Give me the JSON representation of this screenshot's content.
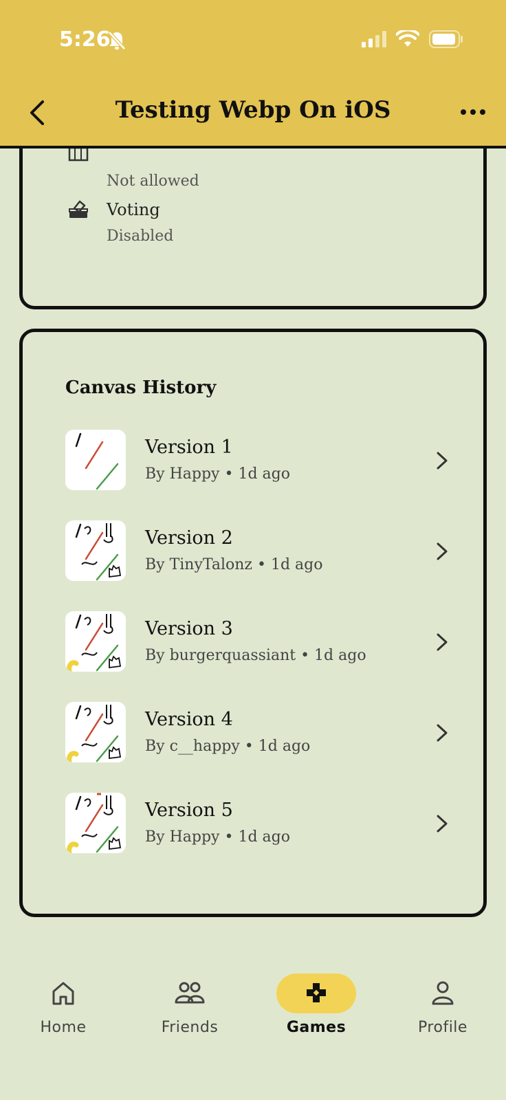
{
  "status_bar": {
    "time": "5:26"
  },
  "header": {
    "title": "Testing Webp On iOS"
  },
  "settings": [
    {
      "label": "",
      "value": "Not allowed",
      "icon": "grid-icon"
    },
    {
      "label": "Voting",
      "value": "Disabled",
      "icon": "ballot-box-icon"
    }
  ],
  "history": {
    "title": "Canvas History",
    "versions": [
      {
        "name": "Version 1",
        "meta": "By Happy • 1d ago"
      },
      {
        "name": "Version 2",
        "meta": "By TinyTalonz • 1d ago"
      },
      {
        "name": "Version 3",
        "meta": "By burgerquassiant • 1d ago"
      },
      {
        "name": "Version 4",
        "meta": "By c__happy • 1d ago"
      },
      {
        "name": "Version 5",
        "meta": "By Happy • 1d ago"
      }
    ]
  },
  "nav": {
    "items": [
      {
        "label": "Home",
        "icon": "home-icon"
      },
      {
        "label": "Friends",
        "icon": "friends-icon"
      },
      {
        "label": "Games",
        "icon": "gamepad-icon",
        "active": true
      },
      {
        "label": "Profile",
        "icon": "profile-icon"
      }
    ]
  },
  "colors": {
    "header": "#e3c352",
    "background": "#dfe8cf",
    "active_pill": "#f3d355"
  }
}
